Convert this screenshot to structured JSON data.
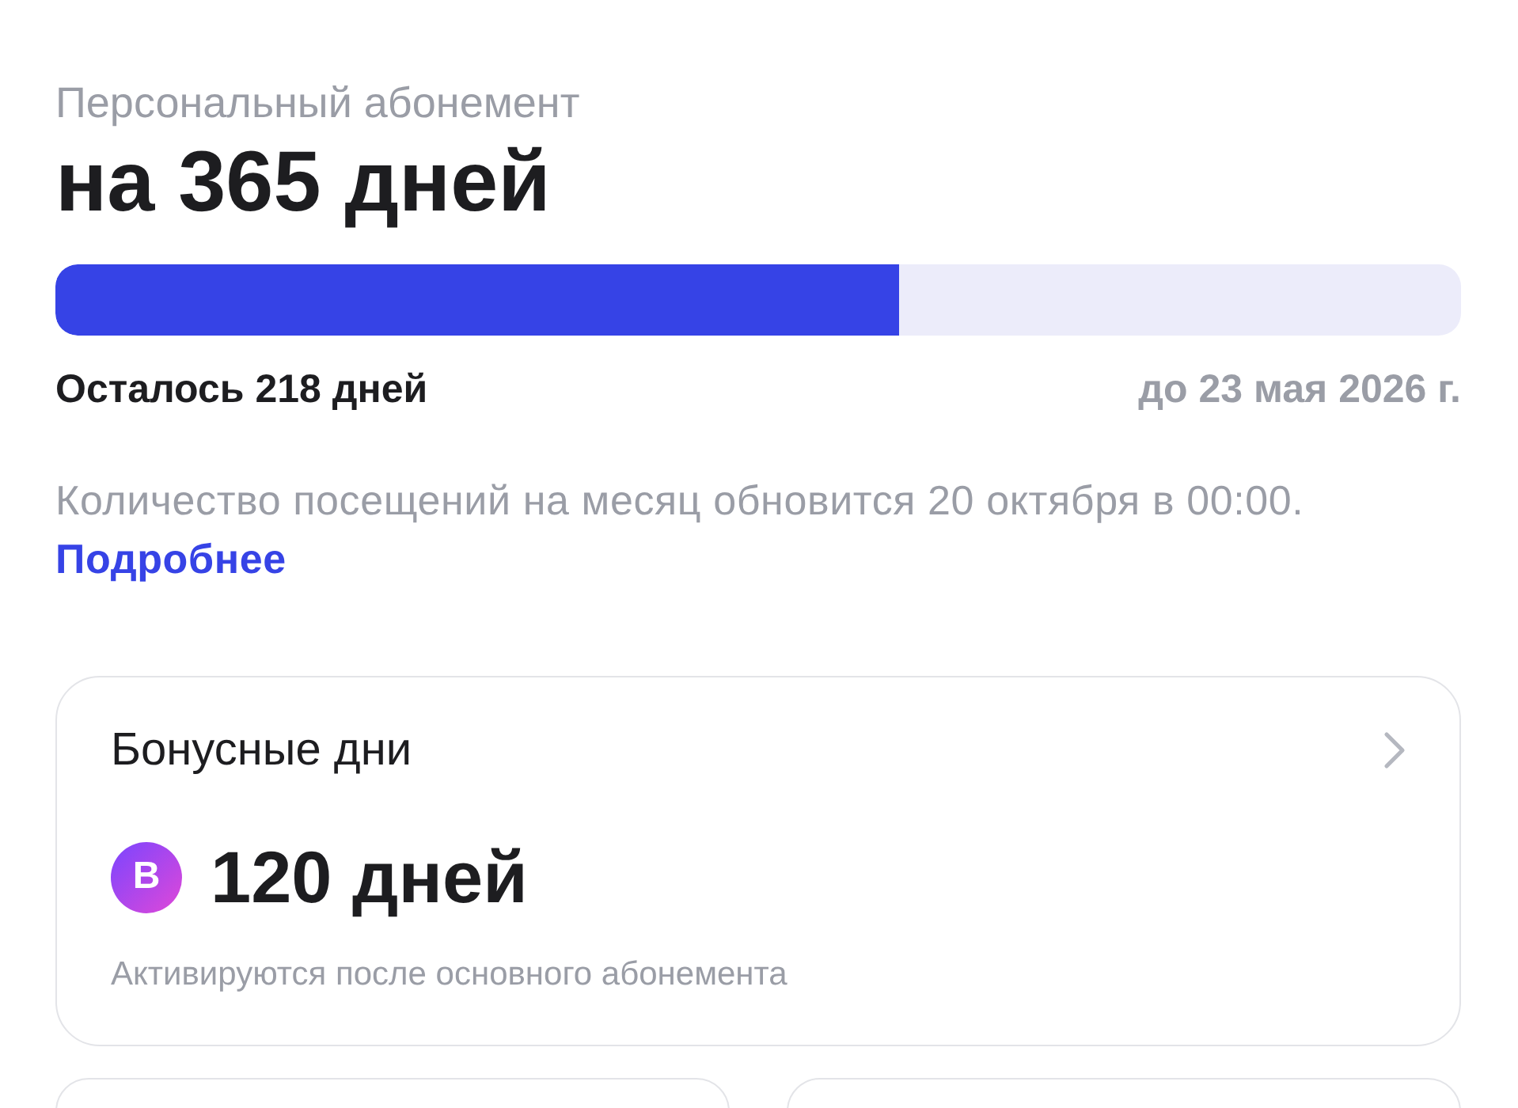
{
  "subscription": {
    "label": "Персональный абонемент",
    "title": "на 365 дней",
    "progress": {
      "level": 0.6
    },
    "remaining": "Осталось 218 дней",
    "until": "до 23 мая 2026 г.",
    "note": "Количество посещений на месяц обновится 20 октября в 00:00.",
    "link": "Подробнее"
  },
  "bonus_card": {
    "title": "Бонусные дни",
    "badge": "B",
    "amount": "120 дней",
    "caption": "Активируются после основного абонемента"
  }
}
